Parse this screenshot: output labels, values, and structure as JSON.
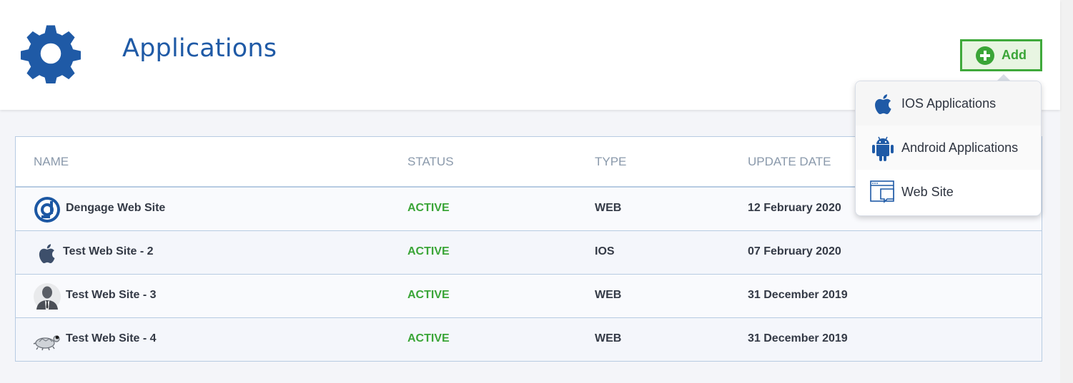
{
  "header": {
    "title": "Applications",
    "add_label": "Add"
  },
  "table": {
    "columns": [
      "NAME",
      "STATUS",
      "TYPE",
      "UPDATE DATE"
    ],
    "rows": [
      {
        "name": "Dengage Web Site",
        "status": "ACTIVE",
        "type": "WEB",
        "date": "12 February 2020",
        "icon": "dengage-logo-icon"
      },
      {
        "name": "Test Web Site - 2",
        "status": "ACTIVE",
        "type": "IOS",
        "date": "07 February 2020",
        "icon": "apple-icon"
      },
      {
        "name": "Test Web Site - 3",
        "status": "ACTIVE",
        "type": "WEB",
        "date": "31 December 2019",
        "icon": "person-avatar-icon"
      },
      {
        "name": "Test Web Site - 4",
        "status": "ACTIVE",
        "type": "WEB",
        "date": "31 December 2019",
        "icon": "turtle-icon"
      }
    ]
  },
  "menu": {
    "items": [
      {
        "label": "IOS Applications",
        "icon": "apple-icon"
      },
      {
        "label": "Android Applications",
        "icon": "android-icon"
      },
      {
        "label": "Web Site",
        "icon": "web-window-icon"
      }
    ]
  },
  "colors": {
    "brand_blue": "#1f5aa6",
    "active_green": "#3aa537",
    "header_gray": "#8a99ab"
  }
}
